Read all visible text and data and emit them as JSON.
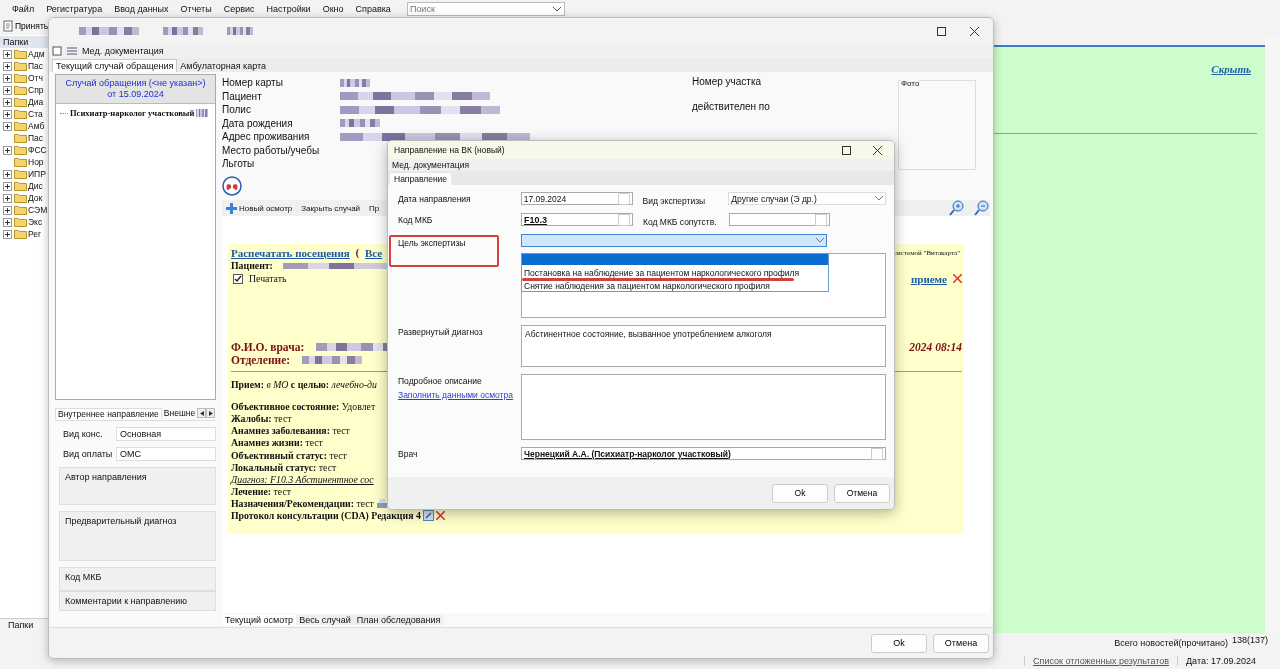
{
  "menu": [
    "Файл",
    "Регистратура",
    "Ввод данных",
    "Отчеты",
    "Сервис",
    "Настройки",
    "Окно",
    "Справка"
  ],
  "search": {
    "placeholder": "Поиск"
  },
  "toolbar": {
    "accept_button": "Принять"
  },
  "folders": {
    "title": "Папки",
    "bottom_tab": "Папки",
    "items": [
      {
        "label": "Адм",
        "collapsed": true
      },
      {
        "label": "Пас",
        "collapsed": true
      },
      {
        "label": "Отч",
        "collapsed": true
      },
      {
        "label": "Спр",
        "collapsed": true
      },
      {
        "label": "Диа",
        "collapsed": true
      },
      {
        "label": "Ста",
        "collapsed": true
      },
      {
        "label": "Амб",
        "collapsed": true
      },
      {
        "label": "Пас",
        "collapsed": false
      },
      {
        "label": "ФСС",
        "collapsed": true
      },
      {
        "label": "Нор",
        "collapsed": false
      },
      {
        "label": "ИПР",
        "collapsed": true
      },
      {
        "label": "Дис",
        "collapsed": true
      },
      {
        "label": "Док",
        "collapsed": true
      },
      {
        "label": "СЭМ",
        "collapsed": true
      },
      {
        "label": "Экс",
        "collapsed": true
      },
      {
        "label": "Рег",
        "collapsed": true
      }
    ]
  },
  "news": {
    "hide_link": "Скрыть",
    "total_label": "Всего новостей(прочитано)",
    "total_value": "138(137)"
  },
  "status_bar": {
    "deferred_link": "Список отложенных результатов",
    "date": "Дата: 17.09.2024"
  },
  "main_window": {
    "toolbar_label": "Мед. документация",
    "tabs": [
      {
        "label": "Текущий случай обращения",
        "selected": true
      },
      {
        "label": "Амбулаторная карта",
        "selected": false
      }
    ],
    "case": {
      "header_line1": "Случай обращения (<не указан>)",
      "header_line2": "от 15.09.2024",
      "items": [
        {
          "label": "Психиатр-нарколог участковый"
        }
      ]
    },
    "referral_tabs": [
      {
        "label": "Внутреннее направление",
        "selected": true
      },
      {
        "label": "Внешне",
        "selected": false
      }
    ],
    "referral_fields": [
      {
        "label": "Вид конс.",
        "value": "Основная"
      },
      {
        "label": "Вид оплаты",
        "value": "ОМС"
      }
    ],
    "referral_groups": [
      "Автор направления",
      "Предварительный диагноз",
      "Код МКБ",
      "Комментарии к направлению"
    ],
    "patient_labels": [
      "Номер карты",
      "Пациент",
      "Полис",
      "Дата рождения",
      "Адрес проживания",
      "Место работы/учебы",
      "Льготы"
    ],
    "site_labels": [
      "Номер участка",
      "действителен по"
    ],
    "photo_label": "Фото",
    "actions": [
      "Новый осмотр",
      "Закрыть случай",
      "Пр"
    ],
    "document": {
      "print_link": "Распечатать посещения",
      "paren": "(",
      "all_link": "Все",
      "patient_label": "Пациент:",
      "print_checkbox": {
        "label": "Печатать",
        "checked": true
      },
      "doctor_label": "Ф.И.О. врача:",
      "department_label": "Отделение:",
      "right_link": "приеме",
      "datetime": "2024 08:14",
      "vendor_note": "системой \"Витакарта\"",
      "lines": [
        {
          "kind": "text",
          "text": "**Прием:** *в МО* **с целью:** *лечебно-ди*"
        },
        {
          "kind": "text",
          "text": "**Объективное состояние:** Удовлет"
        },
        {
          "kind": "text",
          "text": "**Жалобы:** тест"
        },
        {
          "kind": "text",
          "text": "**Анамнез заболевания:** тест"
        },
        {
          "kind": "text",
          "text": "**Анамнез жизни:** тест"
        },
        {
          "kind": "text",
          "text": "**Объективный статус:** тест"
        },
        {
          "kind": "text",
          "text": "**Локальный статус:** тест"
        },
        {
          "kind": "diagnosis",
          "text": "Диагноз: F10.3 Абстинентное сос"
        },
        {
          "kind": "text",
          "text": "**Лечение:** тест"
        },
        {
          "kind": "printable",
          "text": "**Назначения/Рекомендации:** тест"
        },
        {
          "kind": "editable",
          "text": "**Протокол консультации (CDA) Редакция 4**"
        }
      ]
    },
    "bottom_tabs": [
      {
        "label": "Текущий осмотр",
        "selected": true
      },
      {
        "label": "Весь случай",
        "selected": false
      },
      {
        "label": "План обследования",
        "selected": false
      }
    ],
    "buttons": [
      "Ok",
      "Отмена"
    ]
  },
  "dialog": {
    "title": "Направление на ВК (новый)",
    "menu": "Мед. документация",
    "tab": {
      "label": "Направление",
      "selected": true
    },
    "date_label": "Дата направления",
    "date": "17.09.2024",
    "exam_type_label": "Вид экспертизы",
    "exam_type": "Другие случаи (Э др.)",
    "mkb_label": "Код МКБ",
    "mkb": "F10.3",
    "mkb2_label": "Код МКБ сопутств.",
    "goal_label": "Цель экспертизы",
    "goal": {
      "open": true,
      "options": [
        {
          "selected": true
        },
        {
          "label": "Постановка на наблюдение за пациентом наркологического профиля",
          "selected": false
        },
        {
          "label": "Снятие наблюдения за пациентом наркологического профиля",
          "selected": false
        }
      ]
    },
    "diag_label": "Развернутый диагноз",
    "diag": "Абстинентное состояние, вызванное употреблением алкоголя",
    "desc_label": "Подробное описание",
    "fill_link": "Заполнить данными осмотра",
    "doctor_label": "Врач",
    "doctor": "Чернецкий А.А. (Психиатр-нарколог участковый)",
    "buttons": [
      "Ok",
      "Отмена"
    ]
  }
}
